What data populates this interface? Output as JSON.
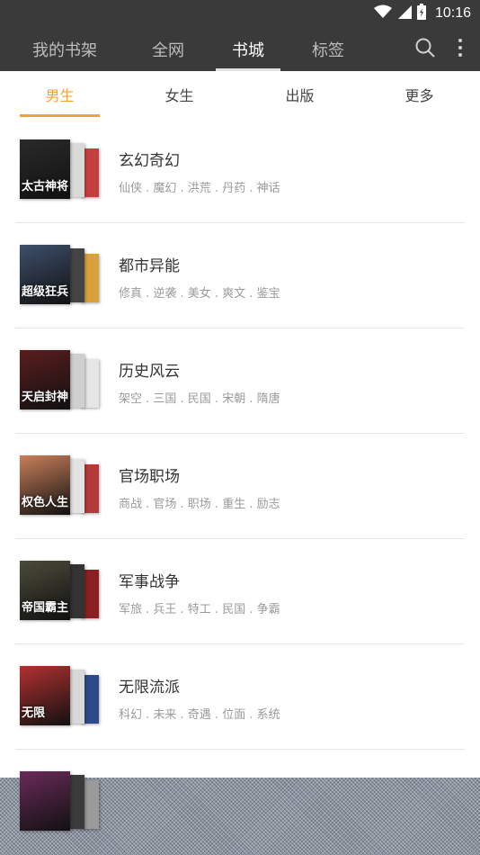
{
  "status_bar": {
    "time": "10:16",
    "icons": [
      "wifi-icon",
      "cell-signal-icon",
      "battery-icon"
    ]
  },
  "top_nav": {
    "tabs": [
      {
        "label": "我的书架",
        "active": false
      },
      {
        "label": "全网",
        "active": false
      },
      {
        "label": "书城",
        "active": true
      },
      {
        "label": "标签",
        "active": false
      }
    ],
    "actions": [
      "search-icon",
      "more-icon"
    ]
  },
  "sub_tabs": [
    {
      "label": "男生",
      "active": true
    },
    {
      "label": "女生",
      "active": false
    },
    {
      "label": "出版",
      "active": false
    },
    {
      "label": "更多",
      "active": false
    }
  ],
  "categories": [
    {
      "title": "玄幻奇幻",
      "tags": "仙侠 . 魔幻 . 洪荒 . 丹药 . 神话",
      "cover_text": "太古神将",
      "colors": [
        "#2a2a2a",
        "#d9d9d9",
        "#c44040"
      ]
    },
    {
      "title": "都市异能",
      "tags": "修真 . 逆袭 . 美女 . 爽文 . 鉴宝",
      "cover_text": "超级狂兵",
      "colors": [
        "#3d4f6b",
        "#444444",
        "#d9a13a"
      ]
    },
    {
      "title": "历史风云",
      "tags": "架空 . 三国 . 民国 . 宋朝 . 隋唐",
      "cover_text": "天启封神",
      "colors": [
        "#5a1d1d",
        "#cfcfcf",
        "#e6e6e6"
      ]
    },
    {
      "title": "官场职场",
      "tags": "商战 . 官场 . 职场 . 重生 . 励志",
      "cover_text": "权色人生",
      "colors": [
        "#c9805a",
        "#e3e3e3",
        "#b33a3a"
      ]
    },
    {
      "title": "军事战争",
      "tags": "军旅 . 兵王 . 特工 . 民国 . 争霸",
      "cover_text": "帝国霸主",
      "colors": [
        "#4b4b3a",
        "#333333",
        "#8a2020"
      ]
    },
    {
      "title": "无限流派",
      "tags": "科幻 . 未来 . 奇遇 . 位面 . 系统",
      "cover_text": "无限",
      "colors": [
        "#b33030",
        "#d8d8d8",
        "#2f4a8a"
      ]
    },
    {
      "title": "",
      "tags": "",
      "cover_text": "",
      "colors": [
        "#6a2a5a",
        "#3b3b3b",
        "#9a9a9a"
      ]
    }
  ]
}
